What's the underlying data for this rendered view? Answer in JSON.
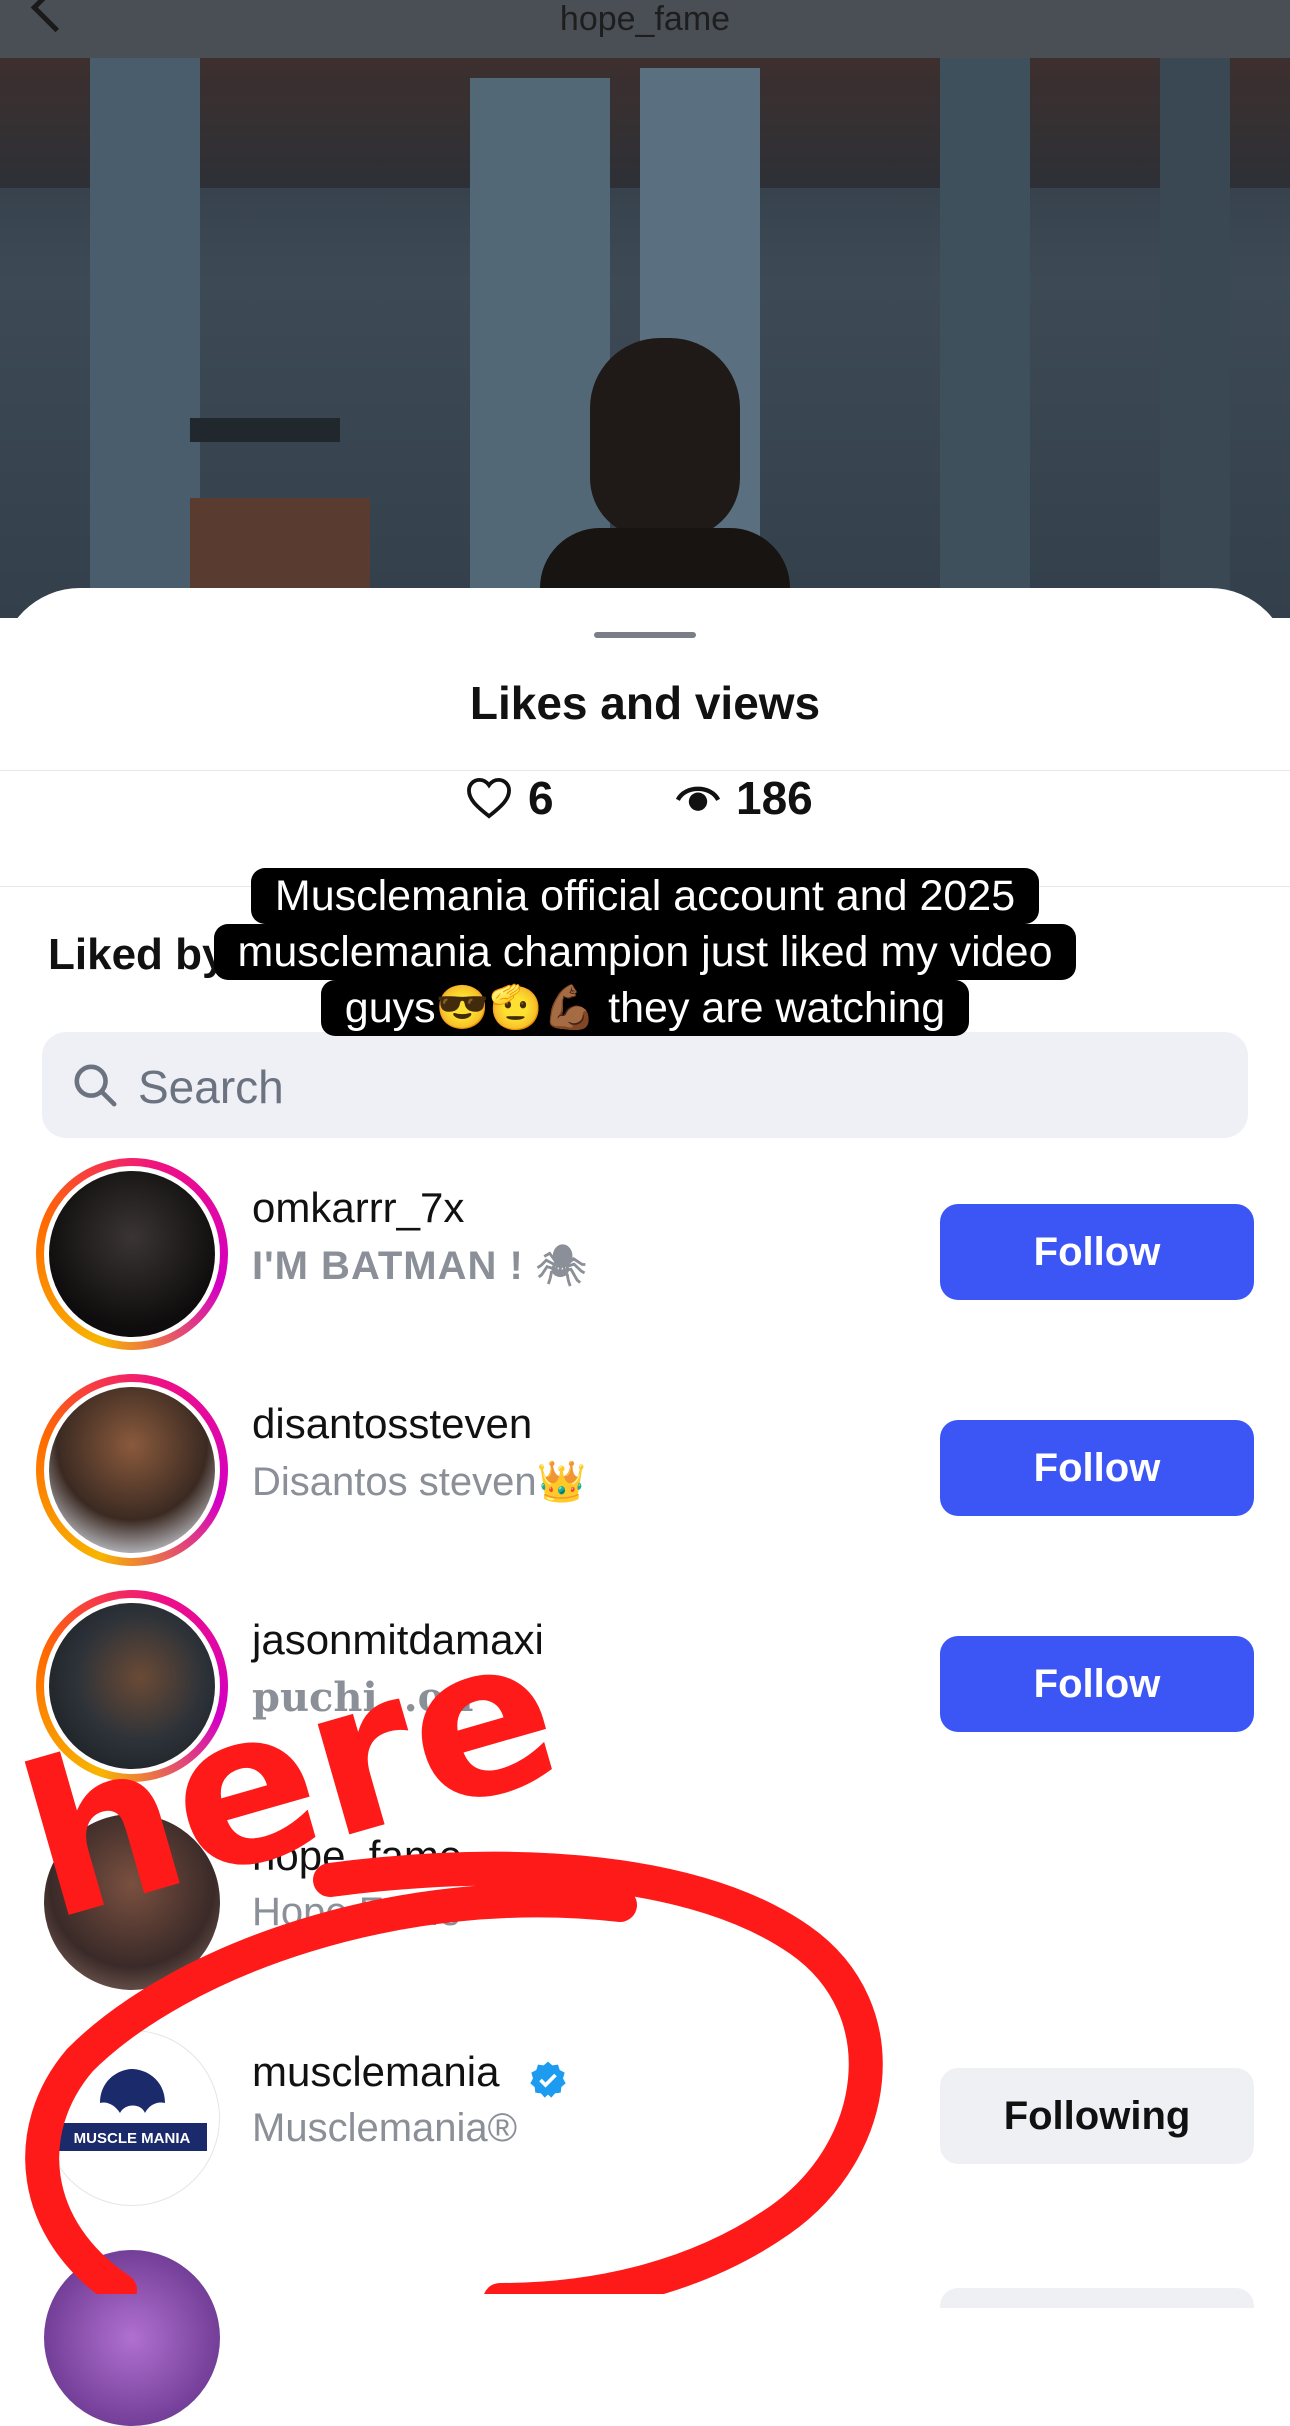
{
  "header": {
    "title": "hope_fame"
  },
  "sheet": {
    "title": "Likes and views",
    "likes_count": "6",
    "views_count": "186",
    "liked_by_label": "Liked by"
  },
  "caption": {
    "lines": [
      "Musclemania official account and 2025",
      "musclemania champion just liked my video",
      "guys😎🫡💪🏾 they are watching"
    ]
  },
  "search": {
    "placeholder": "Search"
  },
  "users": [
    {
      "username": "omkarrr_7x",
      "fullname": "I'M BATMAN ! 🕷",
      "button": "Follow"
    },
    {
      "username": "disantossteven",
      "fullname": "Disantos steven👑",
      "button": "Follow"
    },
    {
      "username": "jasonmitdamaxi",
      "fullname": "puchi…on",
      "button": "Follow"
    },
    {
      "username": "hope_fame",
      "fullname": "Hope Fame",
      "button": ""
    },
    {
      "username": "musclemania",
      "fullname": "Musclemania®",
      "button": "Following"
    }
  ],
  "annotation": {
    "text": "here"
  },
  "colors": {
    "follow_button": "#3c55f5",
    "annotation_red": "#ff1a1a",
    "verified": "#1d9bf0"
  }
}
